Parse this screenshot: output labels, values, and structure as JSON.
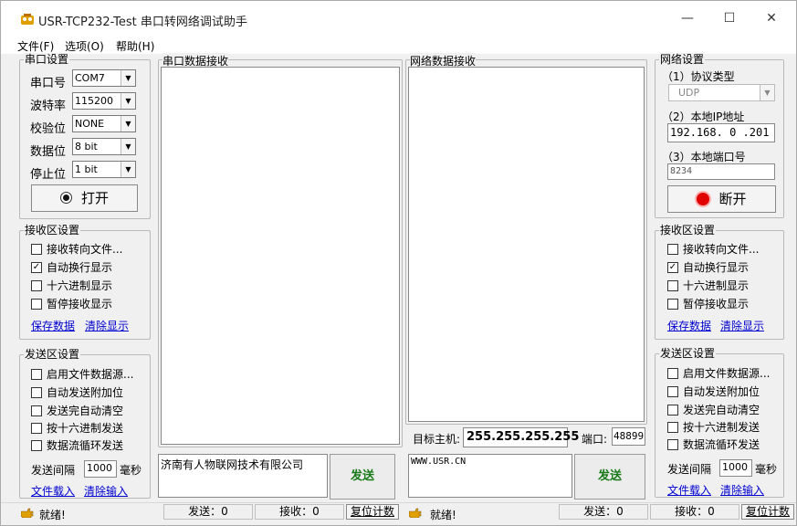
{
  "window": {
    "title": "USR-TCP232-Test 串口转网络调试助手",
    "minimize": "—",
    "maximize": "☐",
    "close": "✕"
  },
  "menu": [
    "文件(F)",
    "选项(O)",
    "帮助(H)"
  ],
  "serial_settings": {
    "title": "串口设置",
    "port_label": "串口号",
    "port_value": "COM7",
    "baud_label": "波特率",
    "baud_value": "115200",
    "parity_label": "校验位",
    "parity_value": "NONE",
    "databits_label": "数据位",
    "databits_value": "8 bit",
    "stopbits_label": "停止位",
    "stopbits_value": "1 bit",
    "open_button": "打开"
  },
  "serial_receive_settings": {
    "title": "接收区设置",
    "options": [
      {
        "label": "接收转向文件...",
        "checked": false
      },
      {
        "label": "自动换行显示",
        "checked": true
      },
      {
        "label": "十六进制显示",
        "checked": false
      },
      {
        "label": "暂停接收显示",
        "checked": false
      }
    ],
    "save_link": "保存数据",
    "clear_link": "清除显示"
  },
  "serial_send_settings": {
    "title": "发送区设置",
    "options": [
      {
        "label": "启用文件数据源...",
        "checked": false
      },
      {
        "label": "自动发送附加位",
        "checked": false
      },
      {
        "label": "发送完自动清空",
        "checked": false
      },
      {
        "label": "按十六进制发送",
        "checked": false
      },
      {
        "label": "数据流循环发送",
        "checked": false
      }
    ],
    "interval_label": "发送间隔",
    "interval_value": "1000",
    "interval_unit": "毫秒",
    "load_link": "文件载入",
    "clear_link": "清除输入"
  },
  "serial_recv_pane": {
    "title": "串口数据接收"
  },
  "net_recv_pane": {
    "title": "网络数据接收"
  },
  "serial_send": {
    "text": "济南有人物联网技术有限公司",
    "button": "发送"
  },
  "net_target": {
    "host_label": "目标主机:",
    "host_value": "255.255.255.255",
    "port_label": "端口:",
    "port_value": "48899"
  },
  "net_send": {
    "text": "WWW.USR.CN",
    "button": "发送"
  },
  "net_settings": {
    "title": "网络设置",
    "protocol_label": "（1）协议类型",
    "protocol_value": "UDP",
    "ip_label": "（2）本地IP地址",
    "ip_parts": [
      "192",
      "168",
      "0",
      "201"
    ],
    "port_label": "（3）本地端口号",
    "port_value": "8234",
    "disconnect_button": "断开"
  },
  "net_receive_settings": {
    "title": "接收区设置",
    "options": [
      {
        "label": "接收转向文件...",
        "checked": false
      },
      {
        "label": "自动换行显示",
        "checked": true
      },
      {
        "label": "十六进制显示",
        "checked": false
      },
      {
        "label": "暂停接收显示",
        "checked": false
      }
    ],
    "save_link": "保存数据",
    "clear_link": "清除显示"
  },
  "net_send_settings": {
    "title": "发送区设置",
    "options": [
      {
        "label": "启用文件数据源...",
        "checked": false
      },
      {
        "label": "自动发送附加位",
        "checked": false
      },
      {
        "label": "发送完自动清空",
        "checked": false
      },
      {
        "label": "按十六进制发送",
        "checked": false
      },
      {
        "label": "数据流循环发送",
        "checked": false
      }
    ],
    "interval_label": "发送间隔",
    "interval_value": "1000",
    "interval_unit": "毫秒",
    "load_link": "文件载入",
    "clear_link": "清除输入"
  },
  "status_serial": {
    "state": "就绪!",
    "sent": "发送：0",
    "received": "接收：0",
    "reset": "复位计数"
  },
  "status_net": {
    "state": "就绪!",
    "sent": "发送：0",
    "received": "接收：0",
    "reset": "复位计数"
  },
  "colors": {
    "status_led_red": "#e00000",
    "send_text_green": "#1a7a1a",
    "link_blue": "#0000d0"
  },
  "icons": {
    "app": "app-icon",
    "radio": "radio-dot-icon",
    "status": "hand-point-icon"
  }
}
